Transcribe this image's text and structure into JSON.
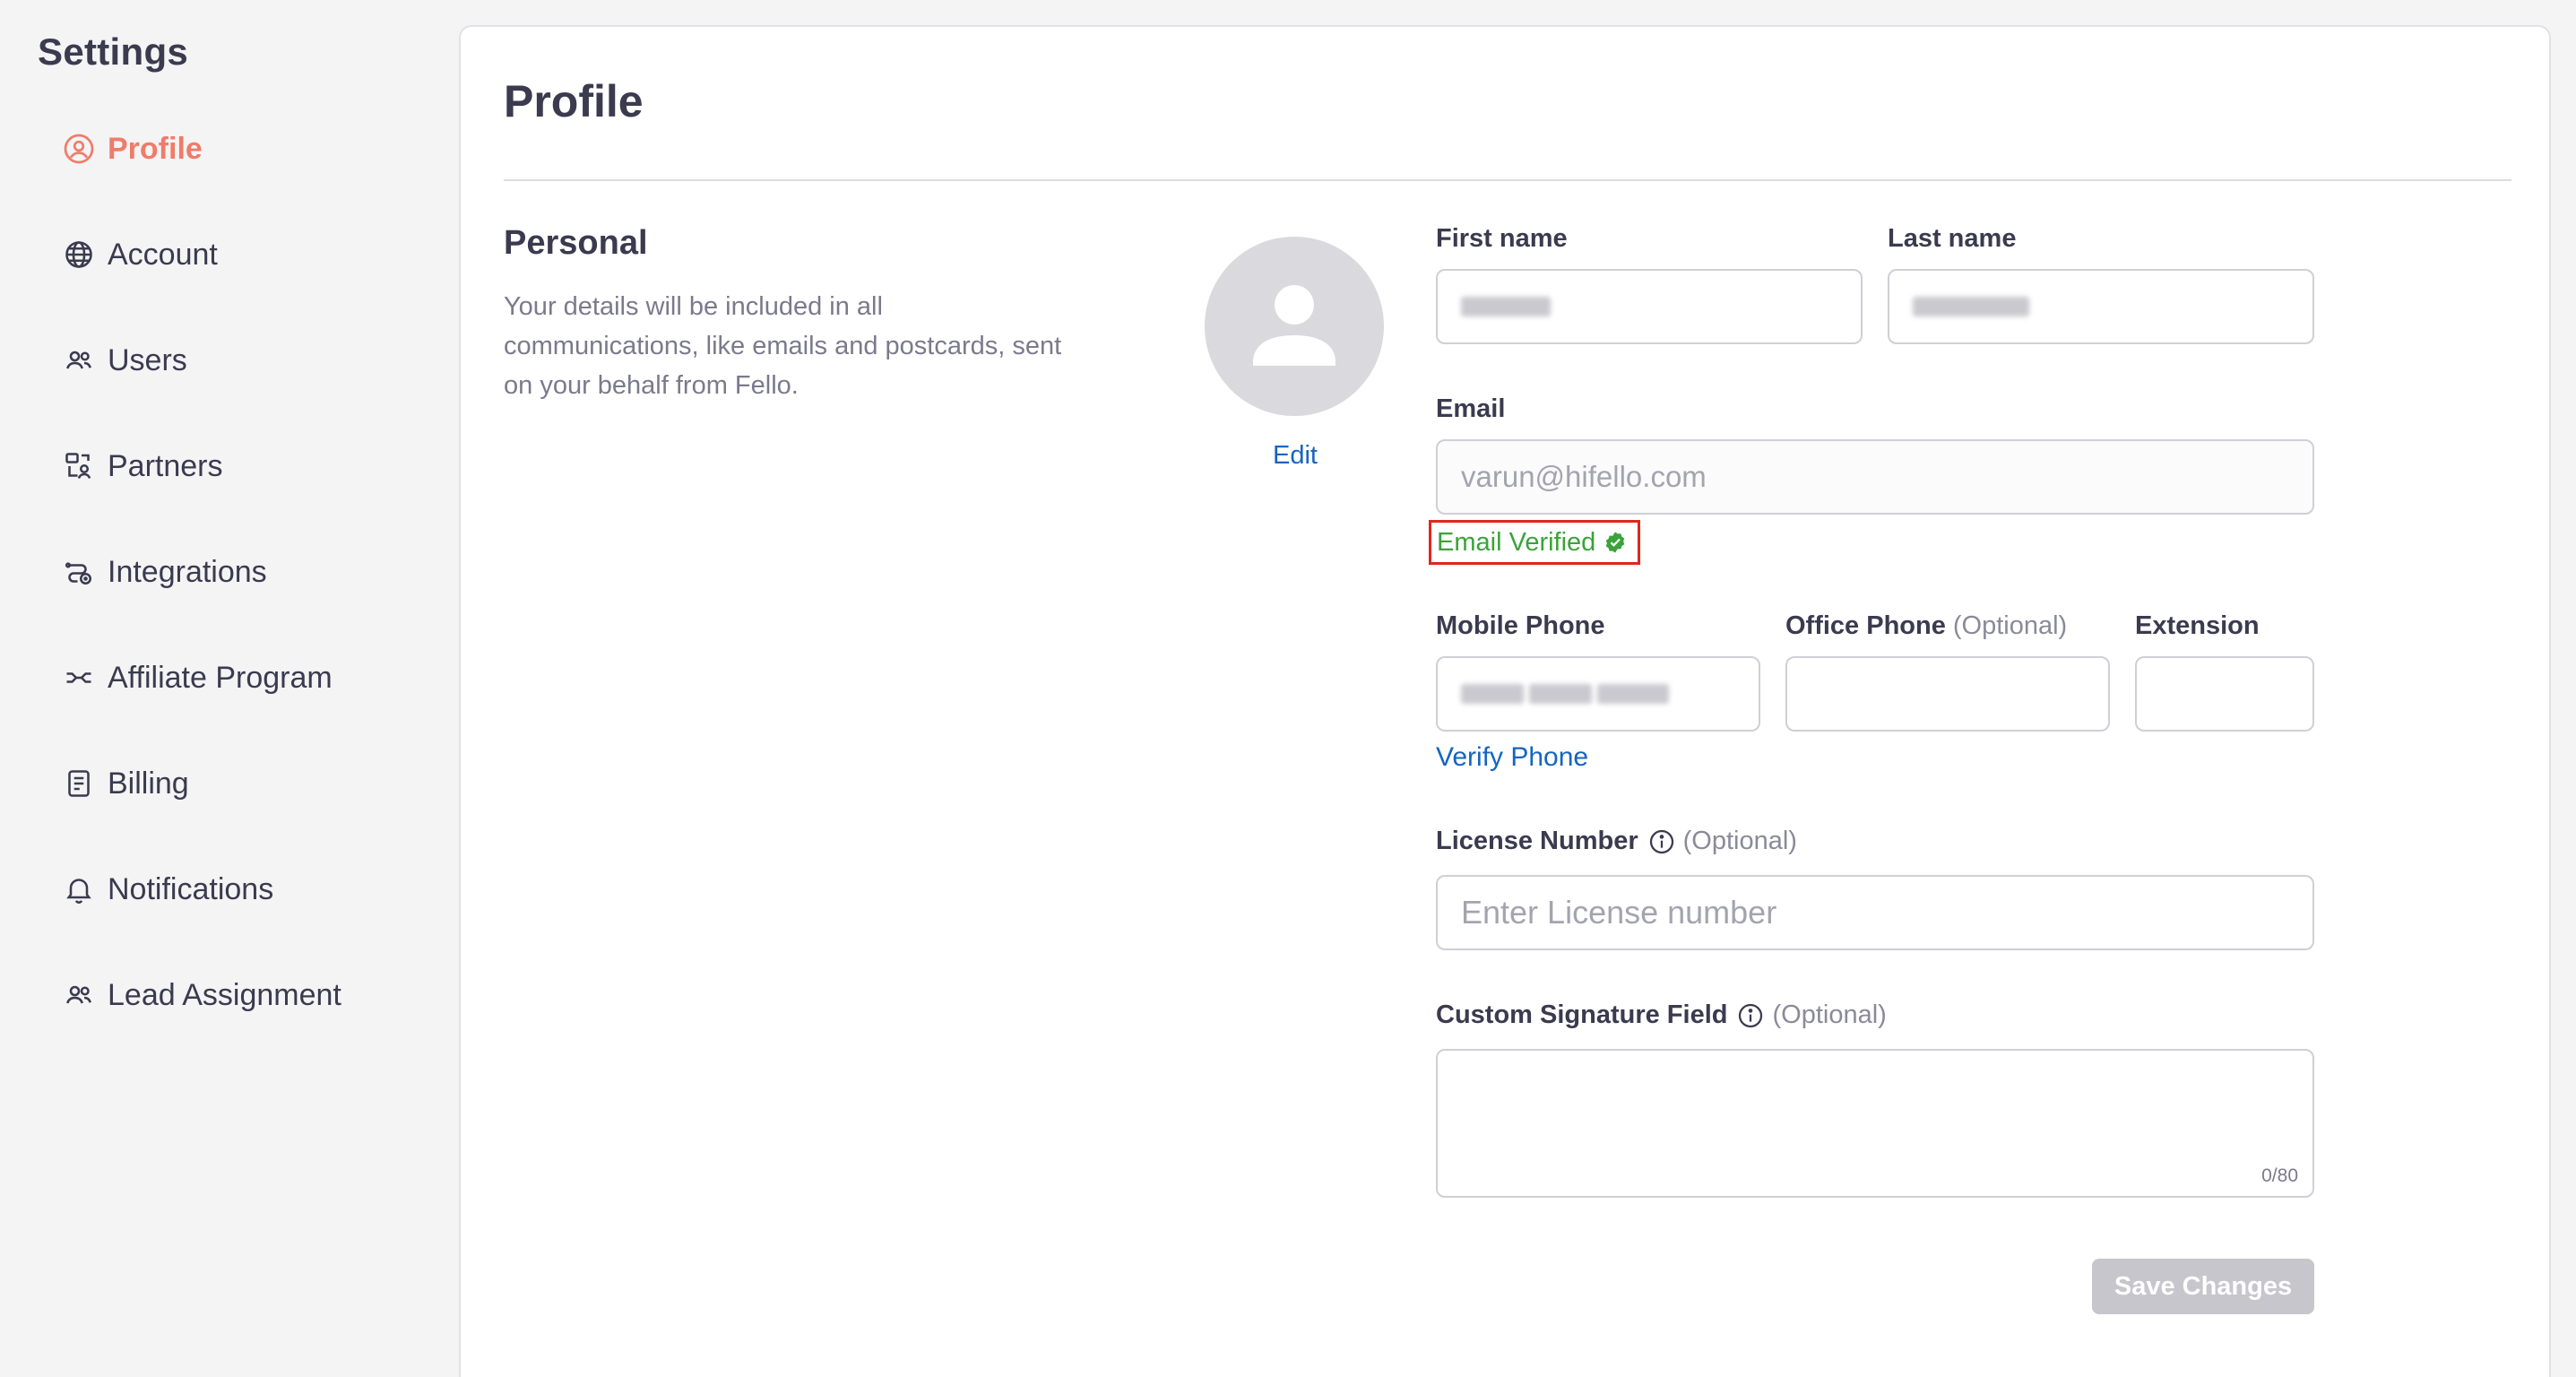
{
  "sidebar": {
    "title": "Settings",
    "items": [
      {
        "label": "Profile",
        "icon": "user-circle-icon",
        "active": true
      },
      {
        "label": "Account",
        "icon": "globe-icon"
      },
      {
        "label": "Users",
        "icon": "users-icon"
      },
      {
        "label": "Partners",
        "icon": "partners-icon"
      },
      {
        "label": "Integrations",
        "icon": "integrations-icon"
      },
      {
        "label": "Affiliate Program",
        "icon": "affiliate-icon"
      },
      {
        "label": "Billing",
        "icon": "billing-icon"
      },
      {
        "label": "Notifications",
        "icon": "bell-icon"
      },
      {
        "label": "Lead Assignment",
        "icon": "users-icon"
      }
    ]
  },
  "main": {
    "title": "Profile",
    "personal": {
      "title": "Personal",
      "description": "Your details will be included in all communications, like emails and postcards, sent on your behalf from Fello."
    },
    "avatar": {
      "edit_label": "Edit"
    },
    "form": {
      "first_name_label": "First name",
      "last_name_label": "Last name",
      "email_label": "Email",
      "email_value": "varun@hifello.com",
      "email_verified_label": "Email Verified",
      "mobile_phone_label": "Mobile Phone",
      "office_phone_label": "Office Phone",
      "optional_label": "(Optional)",
      "extension_label": "Extension",
      "verify_phone_label": "Verify Phone",
      "license_label": "License Number",
      "license_placeholder": "Enter License number",
      "signature_label": "Custom Signature Field",
      "signature_counter": "0/80",
      "save_label": "Save Changes"
    }
  },
  "colors": {
    "accent": "#ef7c6a",
    "link": "#1565c0",
    "verified": "#3aa33a",
    "highlight_box": "#e0261d"
  }
}
